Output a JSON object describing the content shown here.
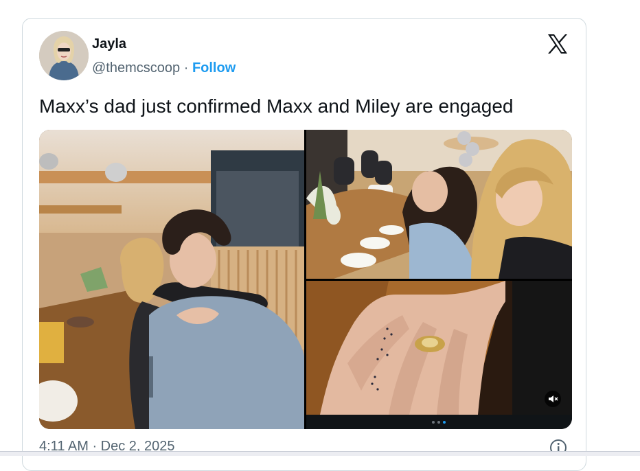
{
  "tweet": {
    "author_name": "Jayla",
    "handle": "@themcscoop",
    "separator": "·",
    "follow_label": "Follow",
    "text": "Maxx’s dad just confirmed Maxx and Miley are engaged",
    "timestamp": "4:11 AM · Dec 2, 2025"
  },
  "media": {
    "photo_count": 3,
    "active_page": 3,
    "page_dots": 3
  },
  "icons": {
    "brand": "x-logo-icon",
    "info": "info-icon",
    "mute": "mute-icon"
  },
  "colors": {
    "accent": "#1d9bf0",
    "text_primary": "#0f1419",
    "text_secondary": "#536471",
    "border": "#cfd9de"
  }
}
